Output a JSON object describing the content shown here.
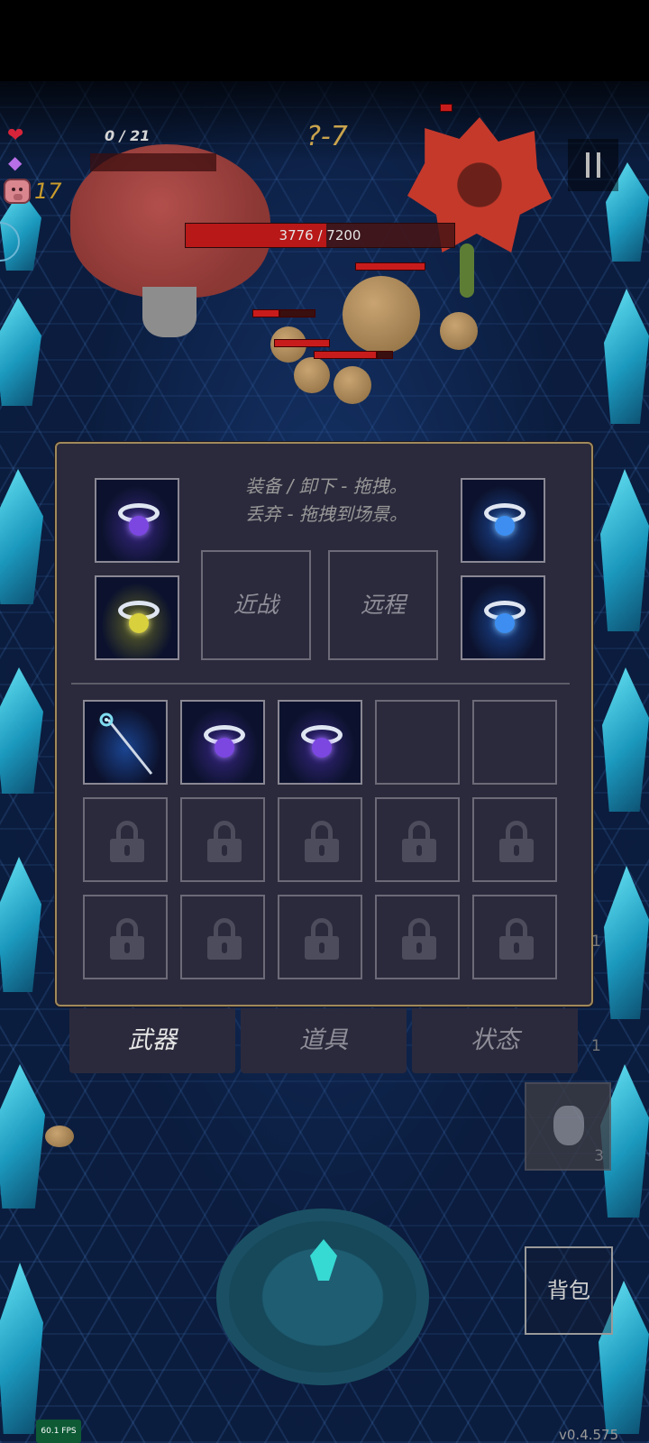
{
  "hud": {
    "hp": "0 / 21",
    "coins": "17",
    "level": "?-7",
    "boss_hp": "3776 / 7200",
    "boss_hp_fraction": 0.524
  },
  "inventory": {
    "hint_line1": "装备 / 卸下 - 拖拽。",
    "hint_line2": "丢弃 - 拖拽到场景。",
    "melee_label": "近战",
    "ranged_label": "远程",
    "equipped_rings": [
      {
        "icon": "purple-ring-icon"
      },
      {
        "icon": "blue-ring-icon"
      },
      {
        "icon": "yellow-ring-icon"
      },
      {
        "icon": "blue-ring-icon"
      }
    ],
    "items": [
      {
        "icon": "staff-icon"
      },
      {
        "icon": "purple-ring-icon"
      },
      {
        "icon": "purple-ring-icon"
      }
    ]
  },
  "tabs": [
    {
      "label": "武器",
      "active": true
    },
    {
      "label": "道具",
      "active": false
    },
    {
      "label": "状态",
      "active": false
    }
  ],
  "quick_items": {
    "count_a": "1",
    "count_b": "1",
    "potion_count": "3"
  },
  "backpack_label": "背包",
  "fps": "60.1 FPS",
  "version": "v0.4.575",
  "colors": {
    "panel_bg": "#2b2a3c",
    "panel_border": "#a08a5a",
    "boss_bar": "#b81818",
    "level_text": "#c9a34d"
  }
}
